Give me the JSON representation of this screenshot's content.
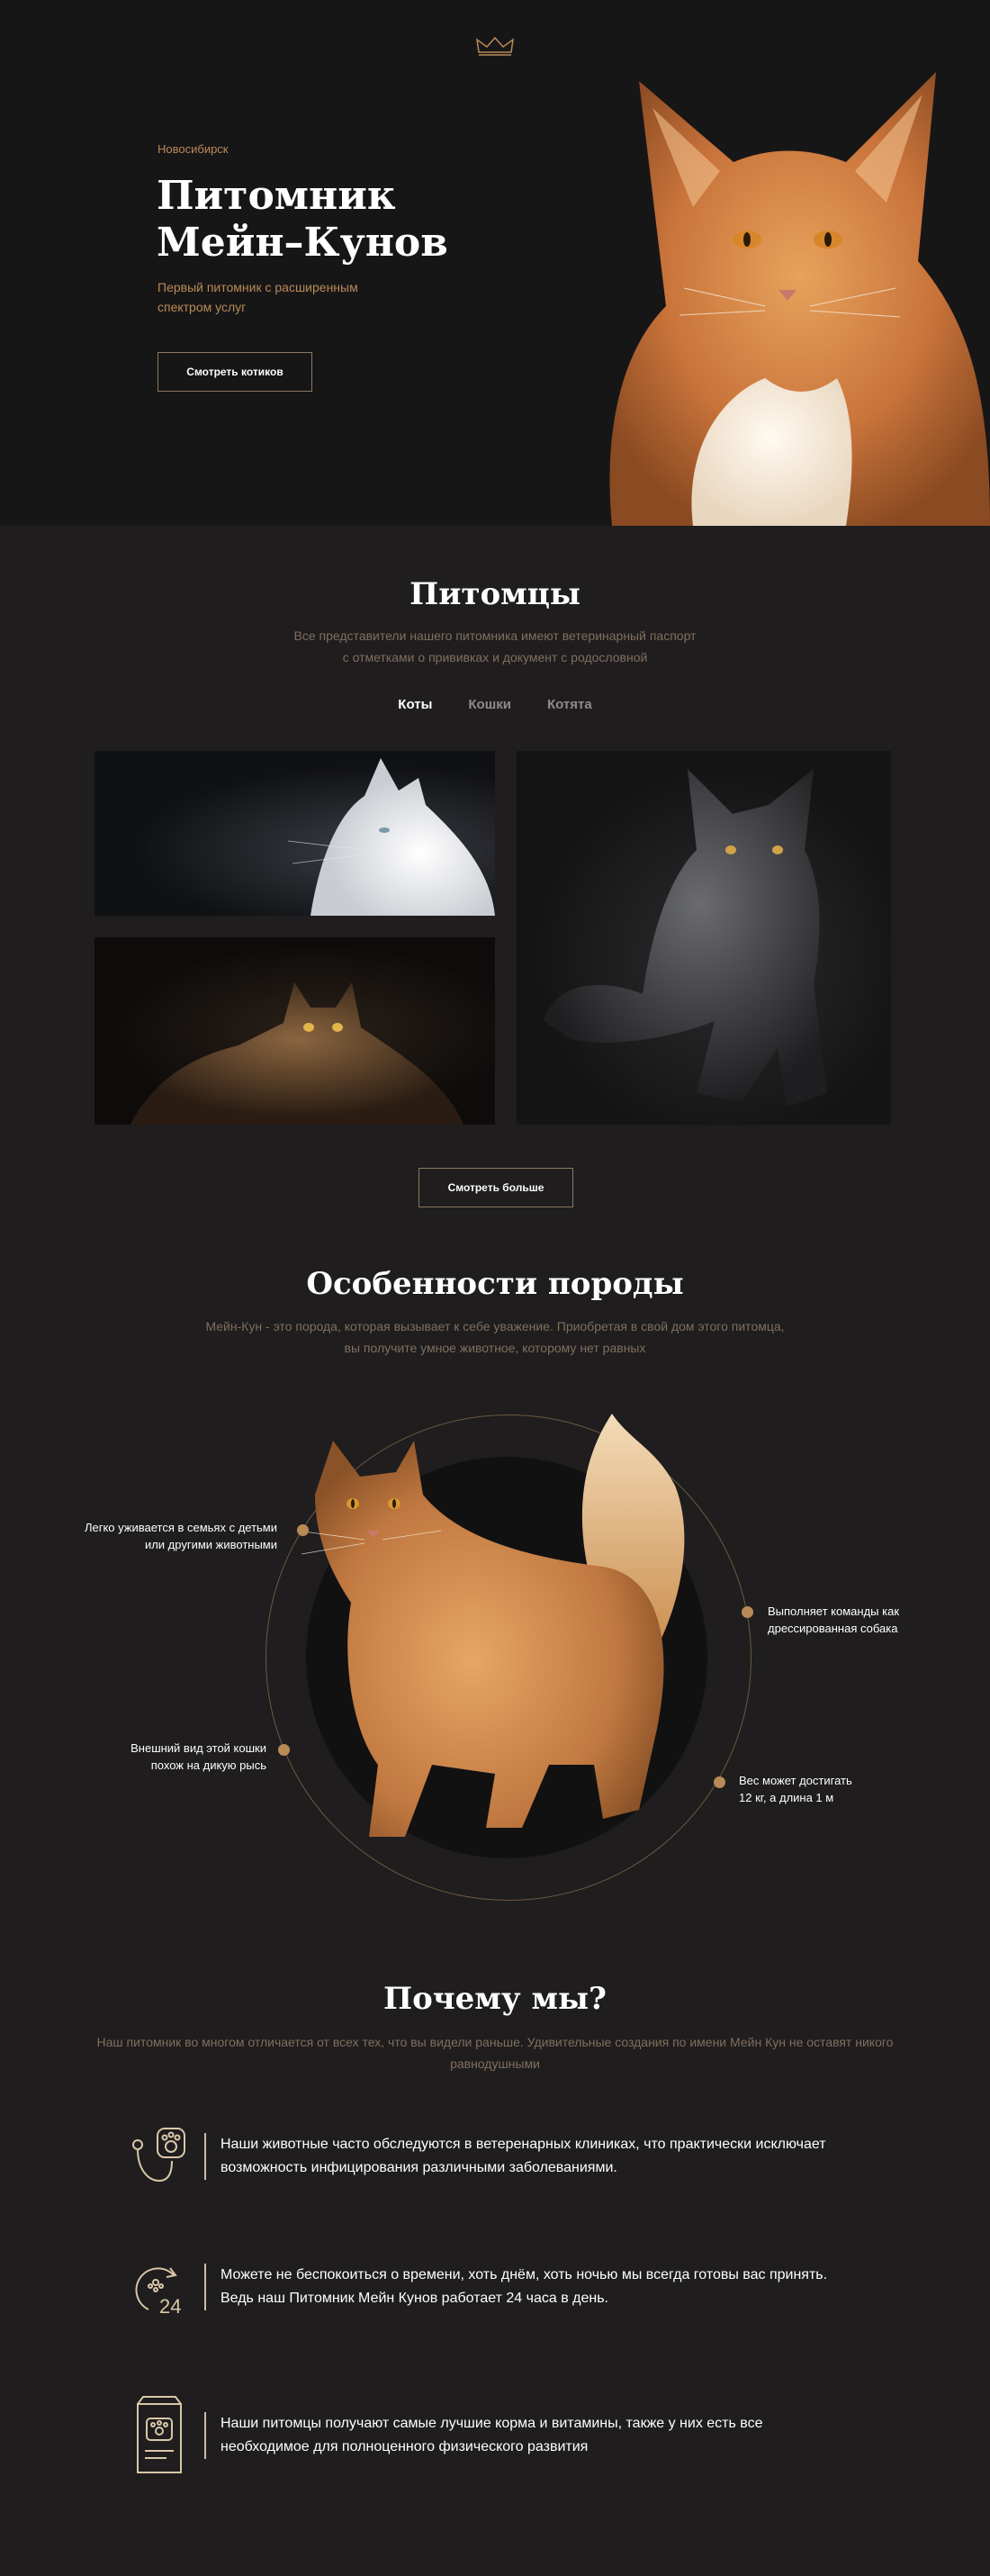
{
  "hero": {
    "city": "Новосибирск",
    "title": "Питомник\nМейн–Кунов",
    "subtitle": "Первый питомник с расширенным спектром услуг",
    "button": "Смотреть котиков",
    "crown_icon": "crown-icon"
  },
  "pets": {
    "title": "Питомцы",
    "description_line1": "Все представители нашего питомника имеют ветеринарный паспорт",
    "description_line2": "с отметками о прививках и документ с родословной",
    "tabs": [
      {
        "label": "Коты",
        "active": true
      },
      {
        "label": "Кошки",
        "active": false
      },
      {
        "label": "Котята",
        "active": false
      }
    ],
    "more_button": "Смотреть больше"
  },
  "features": {
    "title": "Особенности породы",
    "description_line1": "Мейн-Кун - это порода, которая вызывает к себе уважение. Приобретая в свой дом этого питомца,",
    "description_line2": "вы получите умное животное, которому нет равных",
    "items": [
      {
        "text": "Легко уживается в семьях с детьми\nили другими животными"
      },
      {
        "text": "Внешний вид этой кошки\nпохож на дикую рысь"
      },
      {
        "text": "Выполняет команды как\nдрессированная собака"
      },
      {
        "text": "Вес может достигать\n12 кг, а длина 1 м"
      }
    ]
  },
  "why": {
    "title": "Почему мы?",
    "description_line1": "Наш питомник во многом отличается от всех тех, что вы видели раньше. Удивительные создания по имени Мейн Кун не оставят никого",
    "description_line2": "равнодушными",
    "items": [
      {
        "icon": "vet-stethoscope-icon",
        "text": "Наши животные часто обследуются в ветеренарных клиниках, что практически исключает возможность инфицирования различными заболеваниями."
      },
      {
        "icon": "clock-24-icon",
        "text": "Можете не беспокоиться о времени, хоть днём, хоть ночью мы всегда готовы вас принять. Ведь наш Питомник Мейн Кунов работает 24 часа в день."
      },
      {
        "icon": "pet-food-bag-icon",
        "text": "Наши питомцы получают самые лучшие корма и витамины, также у них есть все необходимое для полноценного физического развития"
      }
    ]
  },
  "colors": {
    "background": "#1f1d1e",
    "hero_background": "#171617",
    "accent": "#b98a56",
    "muted_text": "#7f6f5f"
  }
}
